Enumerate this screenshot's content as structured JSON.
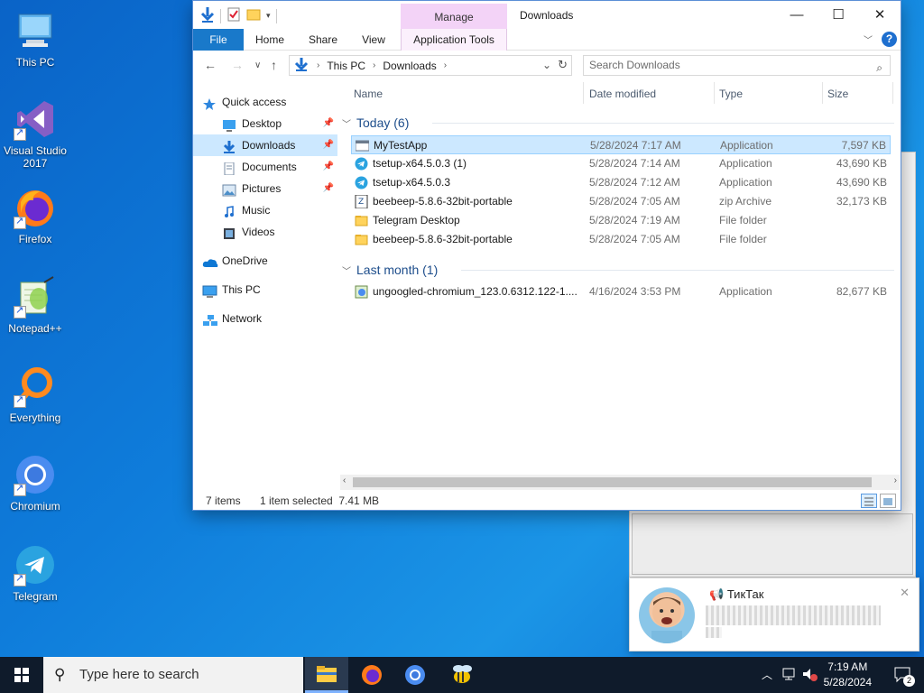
{
  "desktop": {
    "icons": [
      {
        "label": "This PC"
      },
      {
        "label": "Visual Studio 2017"
      },
      {
        "label": "Firefox"
      },
      {
        "label": "Notepad++"
      },
      {
        "label": "Everything"
      },
      {
        "label": "Chromium"
      },
      {
        "label": "Telegram"
      }
    ]
  },
  "window": {
    "title": "Downloads",
    "manage_label": "Manage",
    "tabs": [
      "File",
      "Home",
      "Share",
      "View",
      "Application Tools"
    ]
  },
  "nav": {
    "breadcrumb": [
      "This PC",
      "Downloads"
    ],
    "search_placeholder": "Search Downloads"
  },
  "navpane": {
    "items": [
      {
        "label": "Quick access",
        "icon": "star-icon",
        "level": 0,
        "pinned": false
      },
      {
        "label": "Desktop",
        "icon": "desktop-icon",
        "level": 1,
        "pinned": true
      },
      {
        "label": "Downloads",
        "icon": "download-icon",
        "level": 1,
        "pinned": true,
        "selected": true
      },
      {
        "label": "Documents",
        "icon": "document-icon",
        "level": 1,
        "pinned": true
      },
      {
        "label": "Pictures",
        "icon": "pictures-icon",
        "level": 1,
        "pinned": true
      },
      {
        "label": "Music",
        "icon": "music-icon",
        "level": 1,
        "pinned": false
      },
      {
        "label": "Videos",
        "icon": "video-icon",
        "level": 1,
        "pinned": false
      },
      {
        "label": "OneDrive",
        "icon": "cloud-icon",
        "level": 0,
        "pinned": false
      },
      {
        "label": "This PC",
        "icon": "computer-icon",
        "level": 0,
        "pinned": false
      },
      {
        "label": "Network",
        "icon": "network-icon",
        "level": 0,
        "pinned": false
      }
    ]
  },
  "columns": {
    "name": "Name",
    "date": "Date modified",
    "type": "Type",
    "size": "Size"
  },
  "groups": [
    {
      "title": "Today (6)",
      "files": [
        {
          "name": "MyTestApp",
          "date": "5/28/2024 7:17 AM",
          "type": "Application",
          "size": "7,597 KB",
          "icon": "app-window-icon",
          "selected": true
        },
        {
          "name": "tsetup-x64.5.0.3 (1)",
          "date": "5/28/2024 7:14 AM",
          "type": "Application",
          "size": "43,690 KB",
          "icon": "telegram-icon"
        },
        {
          "name": "tsetup-x64.5.0.3",
          "date": "5/28/2024 7:12 AM",
          "type": "Application",
          "size": "43,690 KB",
          "icon": "telegram-icon"
        },
        {
          "name": "beebeep-5.8.6-32bit-portable",
          "date": "5/28/2024 7:05 AM",
          "type": "zip Archive",
          "size": "32,173 KB",
          "icon": "zip-icon"
        },
        {
          "name": "Telegram Desktop",
          "date": "5/28/2024 7:19 AM",
          "type": "File folder",
          "size": "",
          "icon": "folder-icon"
        },
        {
          "name": "beebeep-5.8.6-32bit-portable",
          "date": "5/28/2024 7:05 AM",
          "type": "File folder",
          "size": "",
          "icon": "folder-icon"
        }
      ]
    },
    {
      "title": "Last month (1)",
      "files": [
        {
          "name": "ungoogled-chromium_123.0.6312.122-1....",
          "date": "4/16/2024 3:53 PM",
          "type": "Application",
          "size": "82,677 KB",
          "icon": "installer-icon"
        }
      ]
    }
  ],
  "status": {
    "count": "7 items",
    "selection": "1 item selected  7.41 MB"
  },
  "toast": {
    "title": "ТикТак"
  },
  "taskbar": {
    "search_placeholder": "Type here to search",
    "time": "7:19 AM",
    "date": "5/28/2024",
    "notification_count": "2"
  },
  "colors": {
    "accent": "#1979ca",
    "selection": "#cce8ff",
    "manage": "#f3d3f7"
  }
}
